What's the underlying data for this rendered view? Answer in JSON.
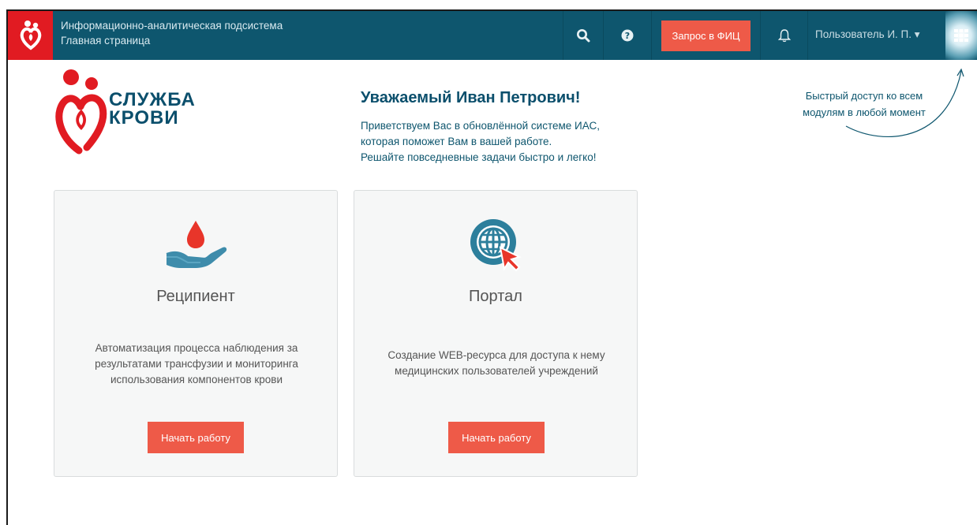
{
  "header": {
    "title_line1": "Информационно-аналитическая подсистема",
    "title_line2": "Главная страница",
    "request_button": "Запрос в ФИЦ",
    "user_label": "Пользователь И. П. ▾",
    "icons": [
      "search-icon",
      "help-icon",
      "bell-icon",
      "grid-menu-icon"
    ]
  },
  "brand": {
    "line1": "СЛУЖБА",
    "line2": "КРОВИ"
  },
  "welcome": {
    "greeting": "Уважаемый Иван Петрович!",
    "line1": "Приветствуем Вас в обновлённой системе ИАС,",
    "line2": "которая поможет Вам в вашей работе.",
    "line3": "Решайте повседневные задачи быстро и легко!"
  },
  "quick_access": {
    "line1": "Быстрый доступ ко всем",
    "line2": "модулям в любой момент"
  },
  "modules": [
    {
      "title": "Реципиент",
      "desc_line1": "Автоматизация процесса наблюдения за",
      "desc_line2": "результатами трансфузии и мониторинга",
      "desc_line3": "использования компонентов крови",
      "button": "Начать работу",
      "icon": "blood-drop-hand-icon"
    },
    {
      "title": "Портал",
      "desc_line1": "Создание WEB-ресурса для доступа к нему",
      "desc_line2": "медицинских пользователей учреждений",
      "button": "Начать работу",
      "icon": "globe-cursor-icon"
    }
  ],
  "colors": {
    "topbar": "#0e566e",
    "logo_bg": "#e11b22",
    "accent_button": "#ee5a48",
    "brand_blue": "#0b4f6c"
  }
}
